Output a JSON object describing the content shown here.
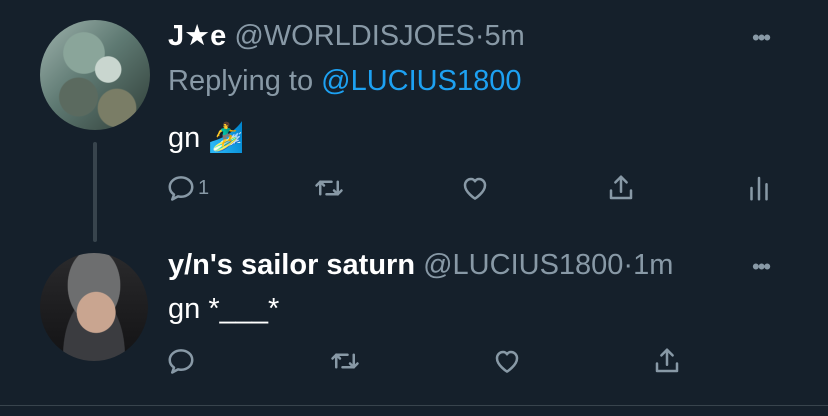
{
  "tweets": [
    {
      "name": "J★e",
      "handle": "@WORLDISJOES",
      "separator": "·",
      "time": "5m",
      "replying_prefix": "Replying to ",
      "replying_handle": "@LUCIUS1800",
      "text": "gn 🏄‍♂️",
      "reply_count": "1",
      "more_label": "•••"
    },
    {
      "name": "y/n's sailor saturn",
      "handle": "@LUCIUS1800",
      "separator": "·",
      "time": "1m",
      "text": "gn *___*",
      "reply_count": "",
      "more_label": "•••"
    }
  ],
  "icons": {
    "reply": "reply-icon",
    "retweet": "retweet-icon",
    "like": "like-icon",
    "share": "share-icon",
    "analytics": "analytics-icon",
    "more": "more-icon"
  },
  "colors": {
    "background": "#15202b",
    "text_primary": "#ffffff",
    "text_muted": "#8899a6",
    "link": "#1da1f2",
    "thread_line": "#38444d"
  }
}
